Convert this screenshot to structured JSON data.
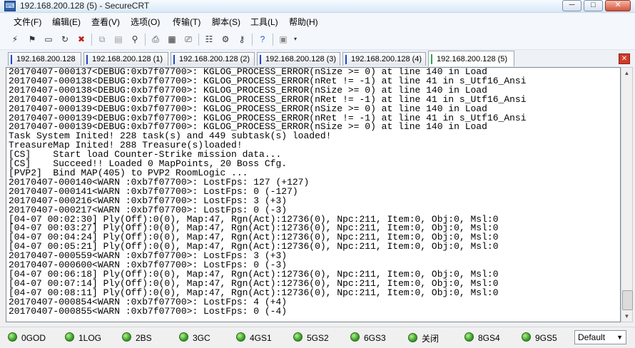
{
  "window": {
    "title": "192.168.200.128 (5) - SecureCRT",
    "minimize": "─",
    "maximize": "□",
    "close": "✕"
  },
  "menu": [
    "文件(F)",
    "编辑(E)",
    "查看(V)",
    "选项(O)",
    "传输(T)",
    "脚本(S)",
    "工具(L)",
    "帮助(H)"
  ],
  "toolbar_icons": [
    "connect-icon",
    "quick-connect-icon",
    "connect-tab-icon",
    "reconnect-icon",
    "disconnect-icon",
    "copy-icon",
    "paste-icon",
    "find-icon",
    "print-icon",
    "print-selection-icon",
    "print-setup-icon",
    "session-options-icon",
    "global-options-icon",
    "key-icon",
    "help-icon",
    "log-icon"
  ],
  "tabs": [
    {
      "label": "192.168.200.128",
      "active": false
    },
    {
      "label": "192.168.200.128 (1)",
      "active": false
    },
    {
      "label": "192.168.200.128 (2)",
      "active": false
    },
    {
      "label": "192.168.200.128 (3)",
      "active": false
    },
    {
      "label": "192.168.200.128 (4)",
      "active": false
    },
    {
      "label": "192.168.200.128 (5)",
      "active": true
    }
  ],
  "tab_close": "✕",
  "terminal_lines": [
    "20170407-000137<DEBUG:0xb7f07700>: KGLOG_PROCESS_ERROR(nSize >= 0) at line 140 in Load",
    "20170407-000138<DEBUG:0xb7f07700>: KGLOG_PROCESS_ERROR(nRet != -1) at line 41 in s_Utf16_Ansi",
    "20170407-000138<DEBUG:0xb7f07700>: KGLOG_PROCESS_ERROR(nSize >= 0) at line 140 in Load",
    "20170407-000139<DEBUG:0xb7f07700>: KGLOG_PROCESS_ERROR(nRet != -1) at line 41 in s_Utf16_Ansi",
    "20170407-000139<DEBUG:0xb7f07700>: KGLOG_PROCESS_ERROR(nSize >= 0) at line 140 in Load",
    "20170407-000139<DEBUG:0xb7f07700>: KGLOG_PROCESS_ERROR(nRet != -1) at line 41 in s_Utf16_Ansi",
    "20170407-000139<DEBUG:0xb7f07700>: KGLOG_PROCESS_ERROR(nSize >= 0) at line 140 in Load",
    "Task System Inited! 228 task(s) and 449 subtask(s) loaded!",
    "TreasureMap Inited! 288 Treasure(s)loaded!",
    "[CS]    Start load Counter-Strike mission data...",
    "[CS]    Succeed!! Loaded 0 MapPoints, 20 Boss Cfg.",
    "[PVP2]  Bind MAP(405) to PVP2 RoomLogic ...",
    "20170407-000140<WARN :0xb7f07700>: LostFps: 127 (+127)",
    "20170407-000141<WARN :0xb7f07700>: LostFps: 0 (-127)",
    "20170407-000216<WARN :0xb7f07700>: LostFps: 3 (+3)",
    "20170407-000217<WARN :0xb7f07700>: LostFps: 0 (-3)",
    "[04-07 00:02:30] Ply(Off):0(0), Map:47, Rgn(Act):12736(0), Npc:211, Item:0, Obj:0, Msl:0",
    "[04-07 00:03:27] Ply(Off):0(0), Map:47, Rgn(Act):12736(0), Npc:211, Item:0, Obj:0, Msl:0",
    "[04-07 00:04:24] Ply(Off):0(0), Map:47, Rgn(Act):12736(0), Npc:211, Item:0, Obj:0, Msl:0",
    "[04-07 00:05:21] Ply(Off):0(0), Map:47, Rgn(Act):12736(0), Npc:211, Item:0, Obj:0, Msl:0",
    "20170407-000559<WARN :0xb7f07700>: LostFps: 3 (+3)",
    "20170407-000600<WARN :0xb7f07700>: LostFps: 0 (-3)",
    "[04-07 00:06:18] Ply(Off):0(0), Map:47, Rgn(Act):12736(0), Npc:211, Item:0, Obj:0, Msl:0",
    "[04-07 00:07:14] Ply(Off):0(0), Map:47, Rgn(Act):12736(0), Npc:211, Item:0, Obj:0, Msl:0",
    "[04-07 00:08:11] Ply(Off):0(0), Map:47, Rgn(Act):12736(0), Npc:211, Item:0, Obj:0, Msl:0",
    "20170407-000854<WARN :0xb7f07700>: LostFps: 4 (+4)",
    "20170407-000855<WARN :0xb7f07700>: LostFps: 0 (-4)"
  ],
  "button_bar": [
    "0GOD",
    "1LOG",
    "2BS",
    "3GC",
    "4GS1",
    "5GS2",
    "6GS3",
    "关闭",
    "8GS4",
    "9GS5"
  ],
  "button_bar_select": "Default",
  "colors": {
    "tab_marker": "#2346c8",
    "active_tab_marker": "#2ea34a",
    "button_dot": "#3aa02a",
    "close_red": "#d23a2a"
  }
}
